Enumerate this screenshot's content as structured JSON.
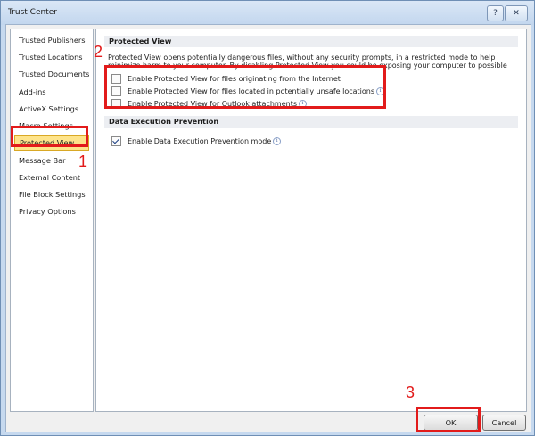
{
  "window": {
    "title": "Trust Center",
    "help_glyph": "?",
    "close_glyph": "✕"
  },
  "sidebar": {
    "items": [
      {
        "label": "Trusted Publishers"
      },
      {
        "label": "Trusted Locations"
      },
      {
        "label": "Trusted Documents"
      },
      {
        "label": "Add-ins"
      },
      {
        "label": "ActiveX Settings"
      },
      {
        "label": "Macro Settings"
      },
      {
        "label": "Protected View",
        "selected": true
      },
      {
        "label": "Message Bar"
      },
      {
        "label": "External Content"
      },
      {
        "label": "File Block Settings"
      },
      {
        "label": "Privacy Options"
      }
    ]
  },
  "protected_view": {
    "heading": "Protected View",
    "description": "Protected View opens potentially dangerous files, without any security prompts, in a restricted mode to help minimize harm to your computer. By disabling Protected View you could be exposing your computer to possible security threats.",
    "options": [
      {
        "label": "Enable Protected View for files originating from the Internet",
        "checked": false
      },
      {
        "label": "Enable Protected View for files located in potentially unsafe locations",
        "checked": false
      },
      {
        "label": "Enable Protected View for Outlook attachments",
        "checked": false
      }
    ]
  },
  "dep": {
    "heading": "Data Execution Prevention",
    "option": {
      "label": "Enable Data Execution Prevention mode",
      "checked": true
    }
  },
  "buttons": {
    "ok": "OK",
    "cancel": "Cancel"
  },
  "annotations": {
    "one": "1",
    "two": "2",
    "three": "3"
  },
  "colors": {
    "highlight": "#e21b1b",
    "selected_bg": "#fee48a"
  }
}
